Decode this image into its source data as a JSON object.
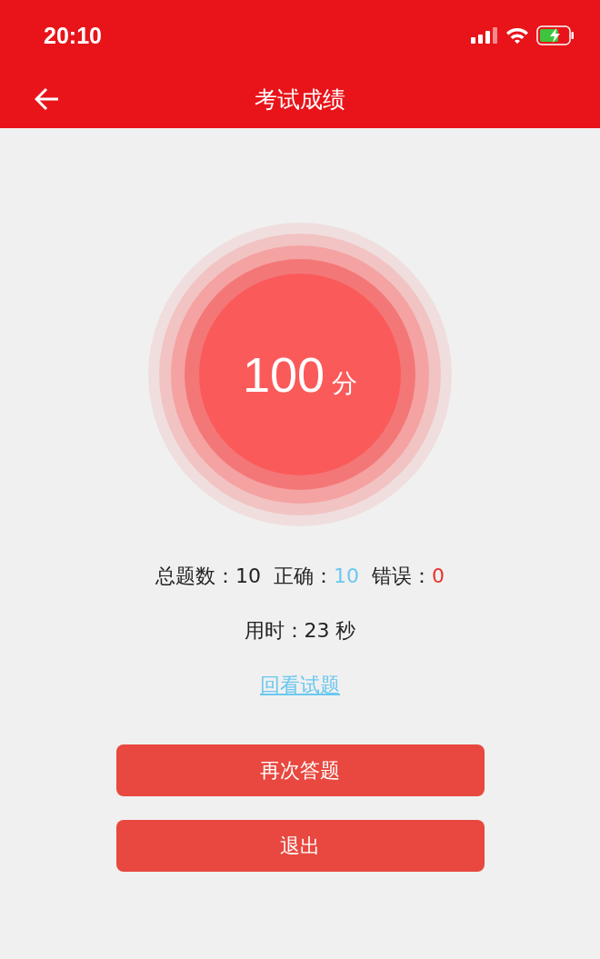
{
  "status_bar": {
    "time": "20:10"
  },
  "header": {
    "title": "考试成绩"
  },
  "score": {
    "value": "100",
    "unit": "分"
  },
  "stats": [
    {
      "label": "总题数：",
      "value": "10",
      "color": "#222222"
    },
    {
      "label": "正确：",
      "value": "10",
      "color": "#6ac8ef"
    },
    {
      "label": "错误：",
      "value": "0",
      "color": "#e8332c"
    }
  ],
  "time_used": "用时：23 秒",
  "review_link": "回看试题",
  "buttons": [
    "再次答题",
    "退出"
  ]
}
